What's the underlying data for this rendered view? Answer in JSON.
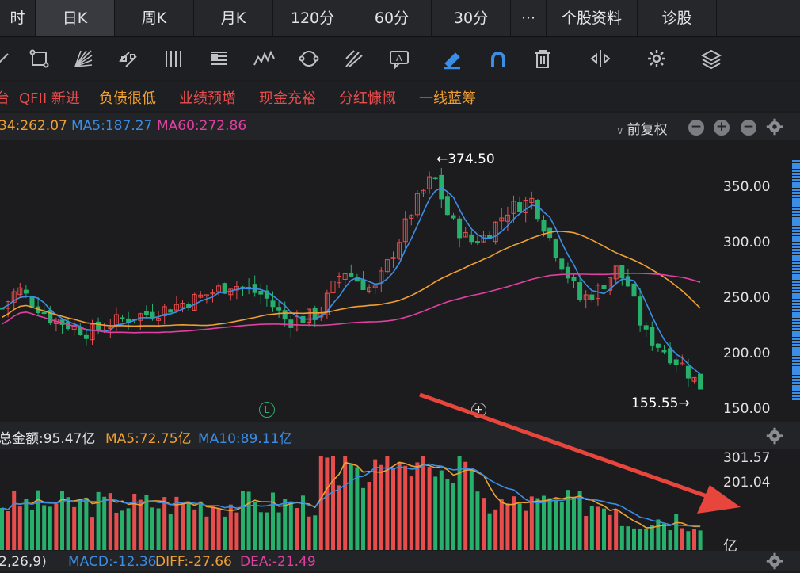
{
  "tabs": {
    "items": [
      {
        "label": "时"
      },
      {
        "label": "日K"
      },
      {
        "label": "周K"
      },
      {
        "label": "月K"
      },
      {
        "label": "120分"
      },
      {
        "label": "60分"
      },
      {
        "label": "30分"
      },
      {
        "label": "···"
      },
      {
        "label": "个股资料"
      },
      {
        "label": "诊股"
      }
    ],
    "active": "日K"
  },
  "toolbar": {
    "icons": [
      "line-icon",
      "rectangle-icon",
      "fan-icon",
      "channel-icon",
      "vertical-lines-icon",
      "text-box-icon",
      "wave-icon",
      "cycle-icon",
      "fork-icon",
      "annotation-icon",
      "highlighter-icon",
      "magnet-icon",
      "trash-icon",
      "flip-icon",
      "settings-icon",
      "layers-icon"
    ]
  },
  "tags": {
    "items": [
      {
        "label": "台",
        "color": "#e84d4d"
      },
      {
        "label": "QFII 新进",
        "color": "#e84d4d"
      },
      {
        "label": "负债很低",
        "color": "#f0a030"
      },
      {
        "label": "业绩预增",
        "color": "#e84d4d"
      },
      {
        "label": "现金充裕",
        "color": "#e84d4d"
      },
      {
        "label": "分红慷慨",
        "color": "#e84d4d"
      },
      {
        "label": "一线蓝筹",
        "color": "#f0a030"
      }
    ]
  },
  "ma_legend": {
    "ma34": "34:262.07",
    "ma5": "MA5:187.27",
    "ma60": "MA60:272.86",
    "adjust": "前复权"
  },
  "price_chart": {
    "axis": [
      "350.00",
      "300.00",
      "250.00",
      "200.00",
      "150.00"
    ],
    "high_label": "←374.50",
    "low_label": "155.55→",
    "l_marker": "L",
    "colors": {
      "up": "#e84d4d",
      "down": "#26b06b",
      "ma5": "#3a8ee6",
      "ma34": "#f0a030",
      "ma60": "#e040a0"
    }
  },
  "volume_panel": {
    "total": "总金额:95.47亿",
    "ma5": "MA5:72.75亿",
    "ma10": "MA10:89.11亿",
    "axis": [
      "301.57",
      "201.04",
      "亿"
    ]
  },
  "macd_panel": {
    "params": "2,26,9)",
    "macd": "MACD:-12.36",
    "diff": "DIFF:-27.66",
    "dea": "DEA:-21.49"
  }
}
